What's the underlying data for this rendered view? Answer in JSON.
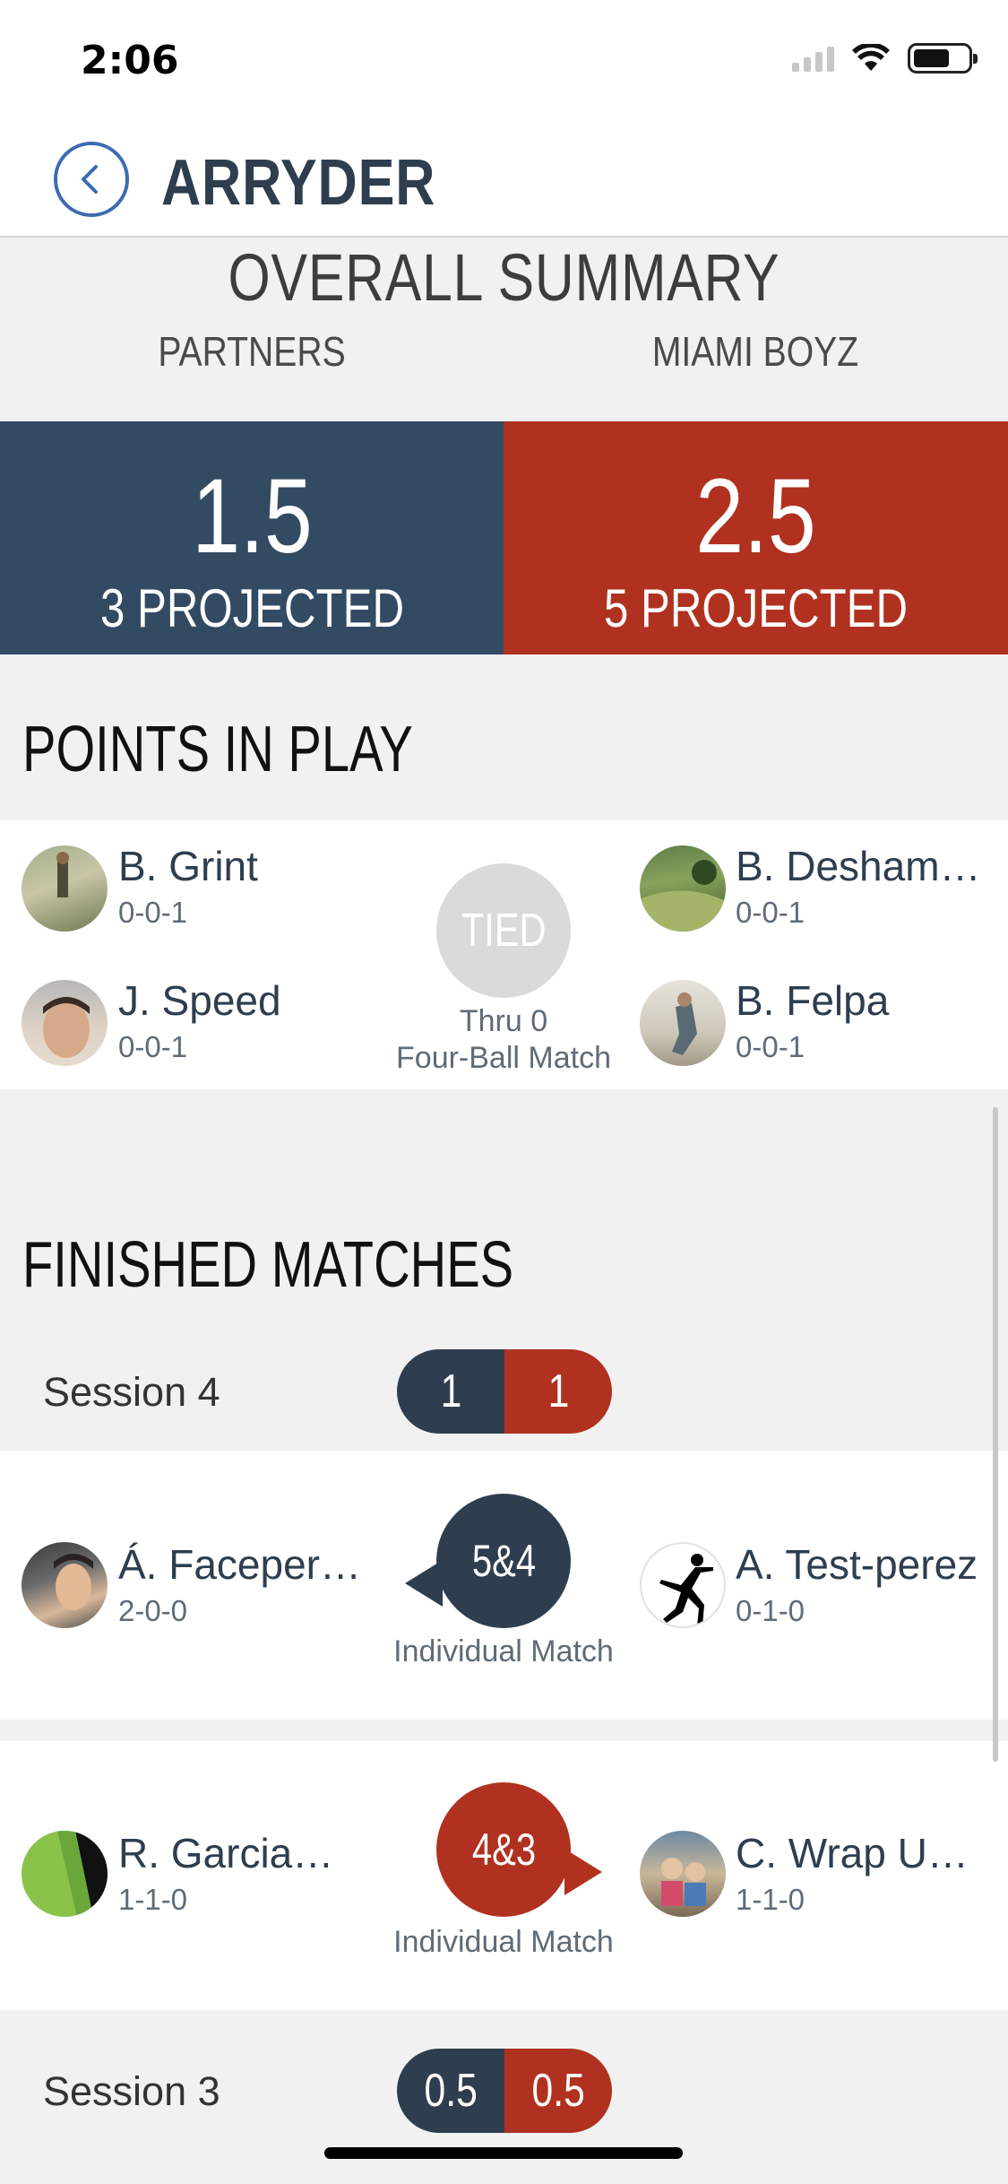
{
  "status_bar": {
    "time": "2:06"
  },
  "nav": {
    "title": "ARRYDER",
    "back_icon": "chevron-left-circle-icon"
  },
  "summary": {
    "title": "OVERALL SUMMARY",
    "team_a": "PARTNERS",
    "team_b": "MIAMI BOYZ",
    "team_a_score": "1.5",
    "team_a_projected": "3 PROJECTED",
    "team_b_score": "2.5",
    "team_b_projected": "5 PROJECTED",
    "team_a_color": "#334a63",
    "team_b_color": "#b0311f"
  },
  "points_in_play": {
    "heading": "POINTS IN PLAY",
    "match": {
      "status": "TIED",
      "thru": "Thru 0",
      "type": "Four-Ball Match",
      "left_players": [
        {
          "name": "B. Grint",
          "record": "0-0-1"
        },
        {
          "name": "J. Speed",
          "record": "0-0-1"
        }
      ],
      "right_players": [
        {
          "name": "B. Desham…",
          "record": "0-0-1"
        },
        {
          "name": "B. Felpa",
          "record": "0-0-1"
        }
      ]
    }
  },
  "finished": {
    "heading": "FINISHED MATCHES",
    "sessions": [
      {
        "label": "Session 4",
        "score_a": "1",
        "score_b": "1",
        "matches": [
          {
            "left": {
              "name": "Á. Faceper…",
              "record": "2-0-0"
            },
            "right": {
              "name": "A. Test-perez",
              "record": "0-1-0"
            },
            "result": "5&4",
            "winner": "left",
            "type": "Individual Match"
          },
          {
            "left": {
              "name": "R. Garcia…",
              "record": "1-1-0"
            },
            "right": {
              "name": "C. Wrap U…",
              "record": "1-1-0"
            },
            "result": "4&3",
            "winner": "right",
            "type": "Individual Match"
          }
        ]
      },
      {
        "label": "Session 3",
        "score_a": "0.5",
        "score_b": "0.5"
      }
    ]
  }
}
